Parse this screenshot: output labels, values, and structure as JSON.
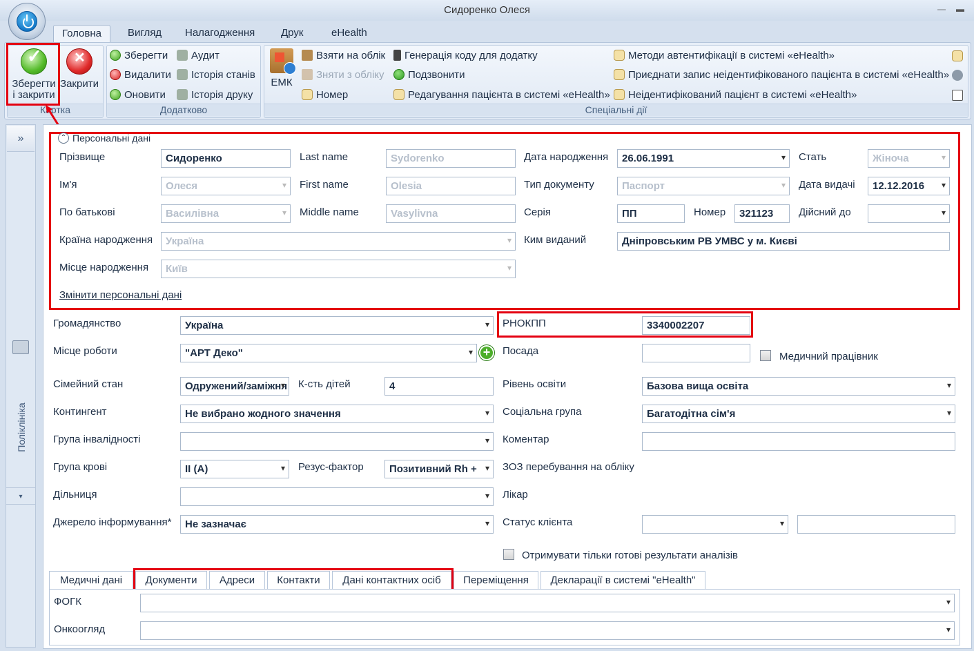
{
  "window": {
    "title": "Сидоренко Олеся"
  },
  "menu_tabs": [
    "Головна",
    "Вигляд",
    "Налагодження",
    "Друк",
    "eHealth"
  ],
  "ribbon": {
    "card_group": {
      "caption": "Картка",
      "save_close_line1": "Зберегти",
      "save_close_line2": "і закрити",
      "close": "Закрити"
    },
    "extra_group": {
      "caption": "Додатково",
      "save": "Зберегти",
      "delete": "Видалити",
      "refresh": "Оновити",
      "audit": "Аудит",
      "state_history": "Історія станів",
      "print_history": "Історія друку"
    },
    "special_group": {
      "caption": "Спеціальні дії",
      "emk": "ЕМК",
      "take_register": "Взяти на облік",
      "remove_register": "Зняти з обліку",
      "number": "Номер",
      "gen_code": "Генерація коду для додатку",
      "call": "Подзвонити",
      "edit_patient": "Редагування пацієнта в системі «eHealth»",
      "auth_methods": "Методи автентифікації в системі «eHealth»",
      "attach_record": "Приєднати запис неідентифікованого пацієнта в системі «eHealth»",
      "unidentified": "Неідентифікований пацієнт в системі «eHealth»"
    }
  },
  "sidebar": {
    "expand": "»",
    "label": "Поліклініка",
    "more": "▾"
  },
  "personal": {
    "legend": "Персональні дані",
    "surname_label": "Прізвище",
    "surname": "Сидоренко",
    "name_label": "Ім'я",
    "name": "Олеся",
    "patronymic_label": "По батькові",
    "patronymic": "Василівна",
    "birth_country_label": "Країна народження",
    "birth_country": "Україна",
    "birth_place_label": "Місце народження",
    "birth_place": "Київ",
    "last_name_label": "Last name",
    "last_name": "Sydorenko",
    "first_name_label": "First name",
    "first_name": "Olesia",
    "middle_name_label": "Middle name",
    "middle_name": "Vasylivna",
    "birth_date_label": "Дата народження",
    "birth_date": "26.06.1991",
    "doc_type_label": "Тип документу",
    "doc_type": "Паспорт",
    "series_label": "Серія",
    "series": "ПП",
    "number_label": "Номер",
    "number": "321123",
    "issued_by_label": "Ким виданий",
    "issued_by": "Дніпровським РВ УМВС  у м. Києві",
    "sex_label": "Стать",
    "sex": "Жіноча",
    "issue_date_label": "Дата видачі",
    "issue_date": "12.12.2016",
    "valid_until_label": "Дійсний до",
    "valid_until": "",
    "change_link": "Змінити персональні дані"
  },
  "form": {
    "citizenship_label": "Громадянство",
    "citizenship": "Україна",
    "rnokpp_label": "РНОКПП",
    "rnokpp": "3340002207",
    "workplace_label": "Місце роботи",
    "workplace": "\"АРТ Деко\"",
    "position_label": "Посада",
    "position": "",
    "medic_label": "Медичний працівник",
    "marital_label": "Сімейний стан",
    "marital": "Одружений/заміжня",
    "children_label": "К-сть дітей",
    "children": "4",
    "education_label": "Рівень освіти",
    "education": "Базова вища освіта",
    "contingent_label": "Контингент",
    "contingent": "Не вибрано жодного значення",
    "social_label": "Соціальна група",
    "social": "Багатодітна сім'я",
    "disability_label": "Група інвалідності",
    "disability": "",
    "comment_label": "Коментар",
    "comment": "",
    "blood_label": "Група крові",
    "blood": "II (A)",
    "rh_label": "Резус-фактор",
    "rh": "Позитивний Rh +",
    "zoz_label": "ЗОЗ перебування на обліку",
    "district_label": "Дільниця",
    "district": "",
    "doctor_label": "Лікар",
    "source_label": "Джерело інформування*",
    "source": "Не зазначає",
    "client_status_label": "Статус клієнта",
    "client_status": "",
    "client_status_extra": "",
    "ready_results_label": "Отримувати тільки готові результати аналізів"
  },
  "bottom_tabs": [
    "Медичні дані",
    "Документи",
    "Адреси",
    "Контакти",
    "Дані контактних осіб",
    "Переміщення",
    "Декларації в системі \"eHealth\""
  ],
  "medical": {
    "fogk_label": "ФОГК",
    "fogk": "",
    "onco_label": "Онкоогляд",
    "onco": ""
  }
}
